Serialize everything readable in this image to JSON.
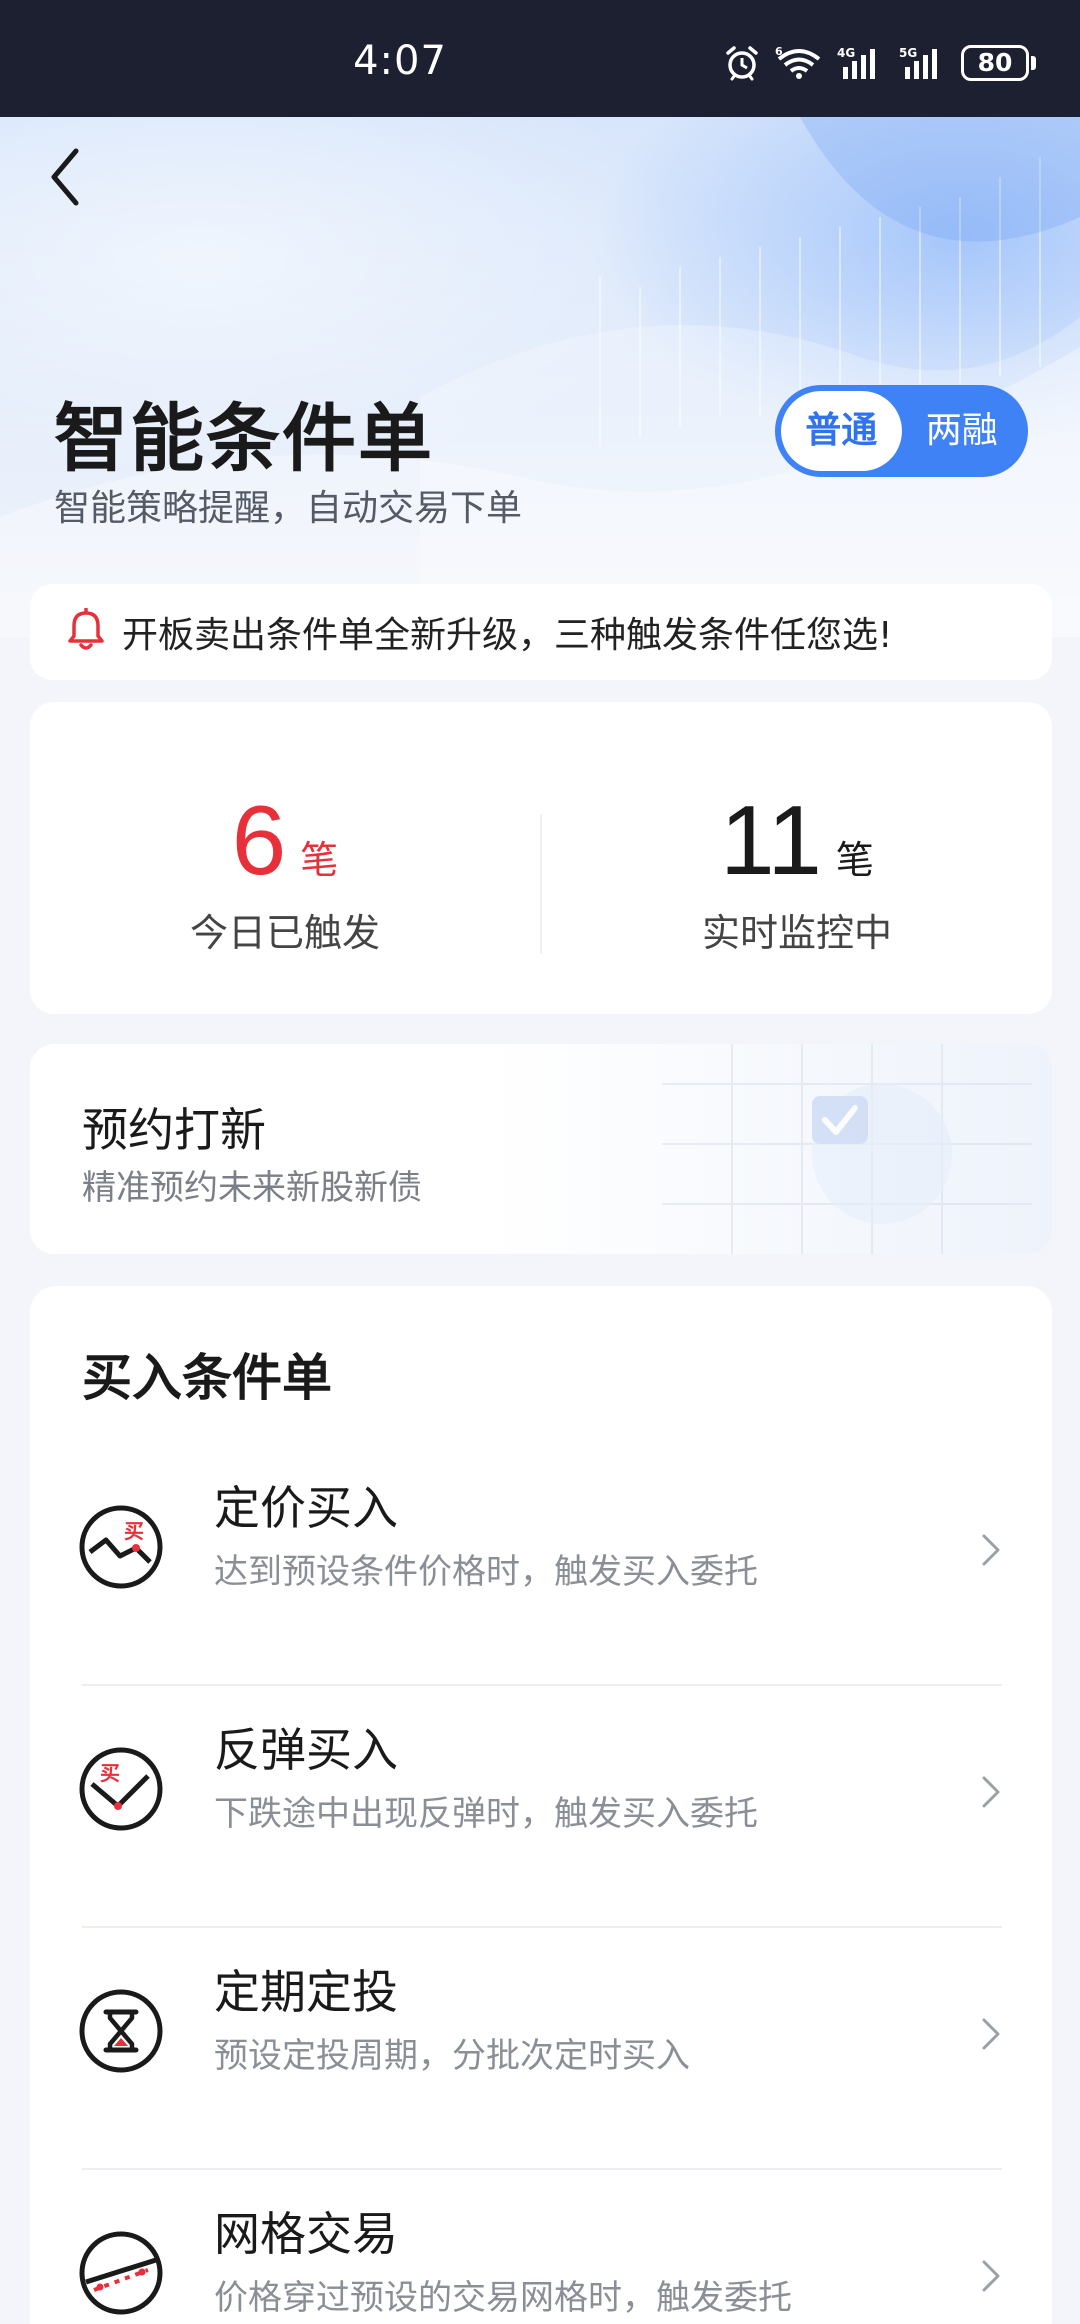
{
  "status_bar": {
    "time": "4:07",
    "battery": "80",
    "icons": [
      "alarm-icon",
      "wifi-6-icon",
      "signal-4g-icon",
      "signal-5g-icon",
      "battery-icon"
    ]
  },
  "header": {
    "back_icon": "chevron-left-icon",
    "title": "智能条件单",
    "subtitle": "智能策略提醒，自动交易下单",
    "mode_toggle": {
      "options": [
        "普通",
        "两融"
      ],
      "selected": "普通"
    }
  },
  "notice": {
    "icon": "bell-icon",
    "text": "开板卖出条件单全新升级，三种触发条件任您选!"
  },
  "stats": {
    "triggered": {
      "value": "6",
      "unit": "笔",
      "label": "今日已触发"
    },
    "monitoring": {
      "value": "11",
      "unit": "笔",
      "label": "实时监控中"
    }
  },
  "ipo": {
    "title": "预约打新",
    "subtitle": "精准预约未来新股新债"
  },
  "buy_section": {
    "title": "买入条件单",
    "items": [
      {
        "name": "定价买入",
        "desc": "达到预设条件价格时，触发买入委托",
        "icon": "price-buy-icon"
      },
      {
        "name": "反弹买入",
        "desc": "下跌途中出现反弹时，触发买入委托",
        "icon": "rebound-buy-icon"
      },
      {
        "name": "定期定投",
        "desc": "预设定投周期，分批次定时买入",
        "icon": "hourglass-icon"
      },
      {
        "name": "网格交易",
        "desc": "价格穿过预设的交易网格时，触发委托",
        "icon": "grid-trade-icon"
      }
    ]
  },
  "colors": {
    "accent": "#3f82f5",
    "red": "#e8303a",
    "status_bar_bg": "#1c2030"
  }
}
